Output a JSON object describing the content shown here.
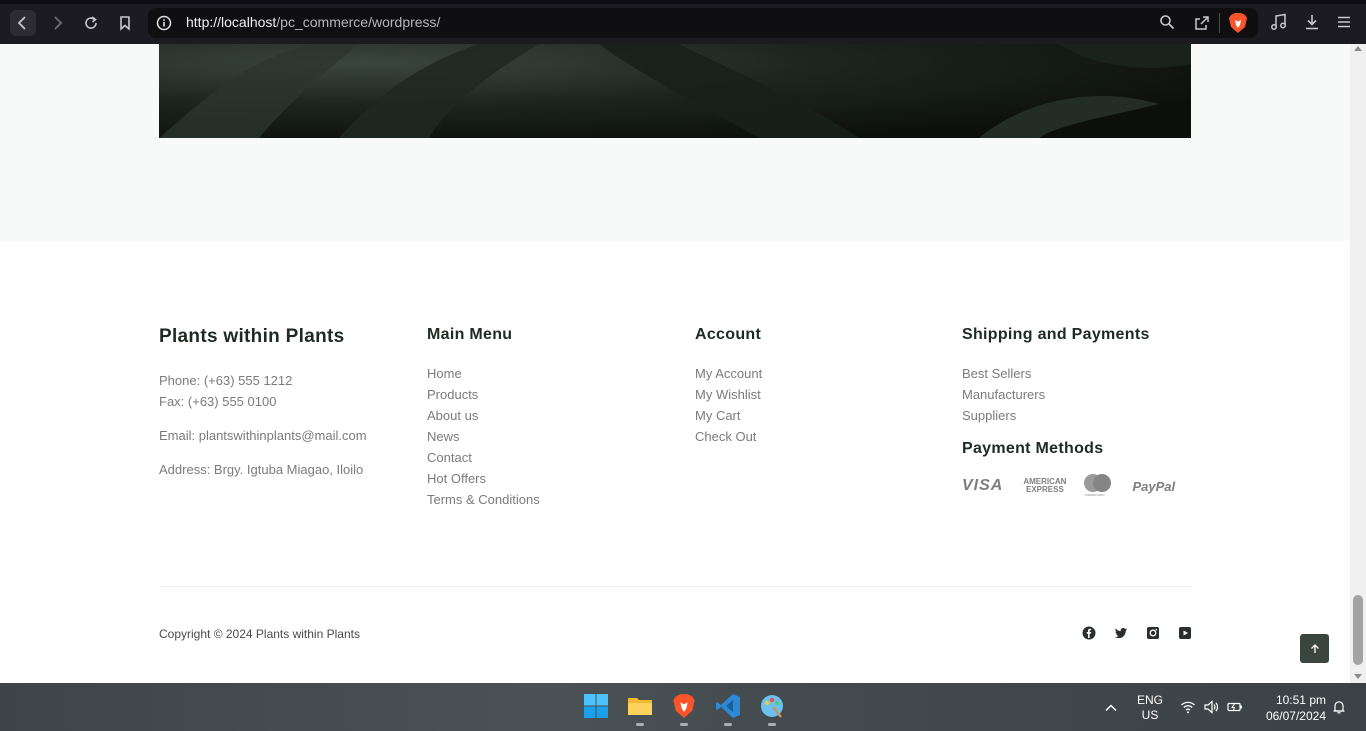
{
  "browser": {
    "url_host": "http://localhost",
    "url_path": "/pc_commerce/wordpress/"
  },
  "footer": {
    "brand": {
      "title": "Plants within Plants",
      "phone": "Phone: (+63) 555 1212",
      "fax": "Fax: (+63) 555 0100",
      "email": "Email: plantswithinplants@mail.com",
      "address": "Address: Brgy. Igtuba Miagao, Iloilo"
    },
    "main_menu": {
      "title": "Main Menu",
      "items": [
        "Home",
        "Products",
        "About us",
        "News",
        "Contact",
        "Hot Offers",
        "Terms & Conditions"
      ]
    },
    "account": {
      "title": "Account",
      "items": [
        "My Account",
        "My Wishlist",
        "My Cart",
        "Check Out"
      ]
    },
    "shipping": {
      "title": "Shipping and Payments",
      "items": [
        "Best Sellers",
        "Manufacturers",
        "Suppliers"
      ]
    },
    "payment": {
      "title": "Payment Methods",
      "visa": "VISA",
      "amex_line1": "AMERICAN",
      "amex_line2": "EXPRESS",
      "mastercard": "mastercard",
      "paypal": "PayPal"
    },
    "copyright": "Copyright © 2024 Plants within Plants",
    "social": [
      "facebook-icon",
      "twitter-icon",
      "instagram-icon",
      "youtube-icon"
    ]
  },
  "taskbar": {
    "lang_line1": "ENG",
    "lang_line2": "US",
    "time": "10:51 pm",
    "date": "06/07/2024"
  },
  "colors": {
    "browser_bg": "#1c1b22",
    "heading": "#1f2a24",
    "link": "#7b7b7b",
    "accent_button": "#3a4540"
  }
}
